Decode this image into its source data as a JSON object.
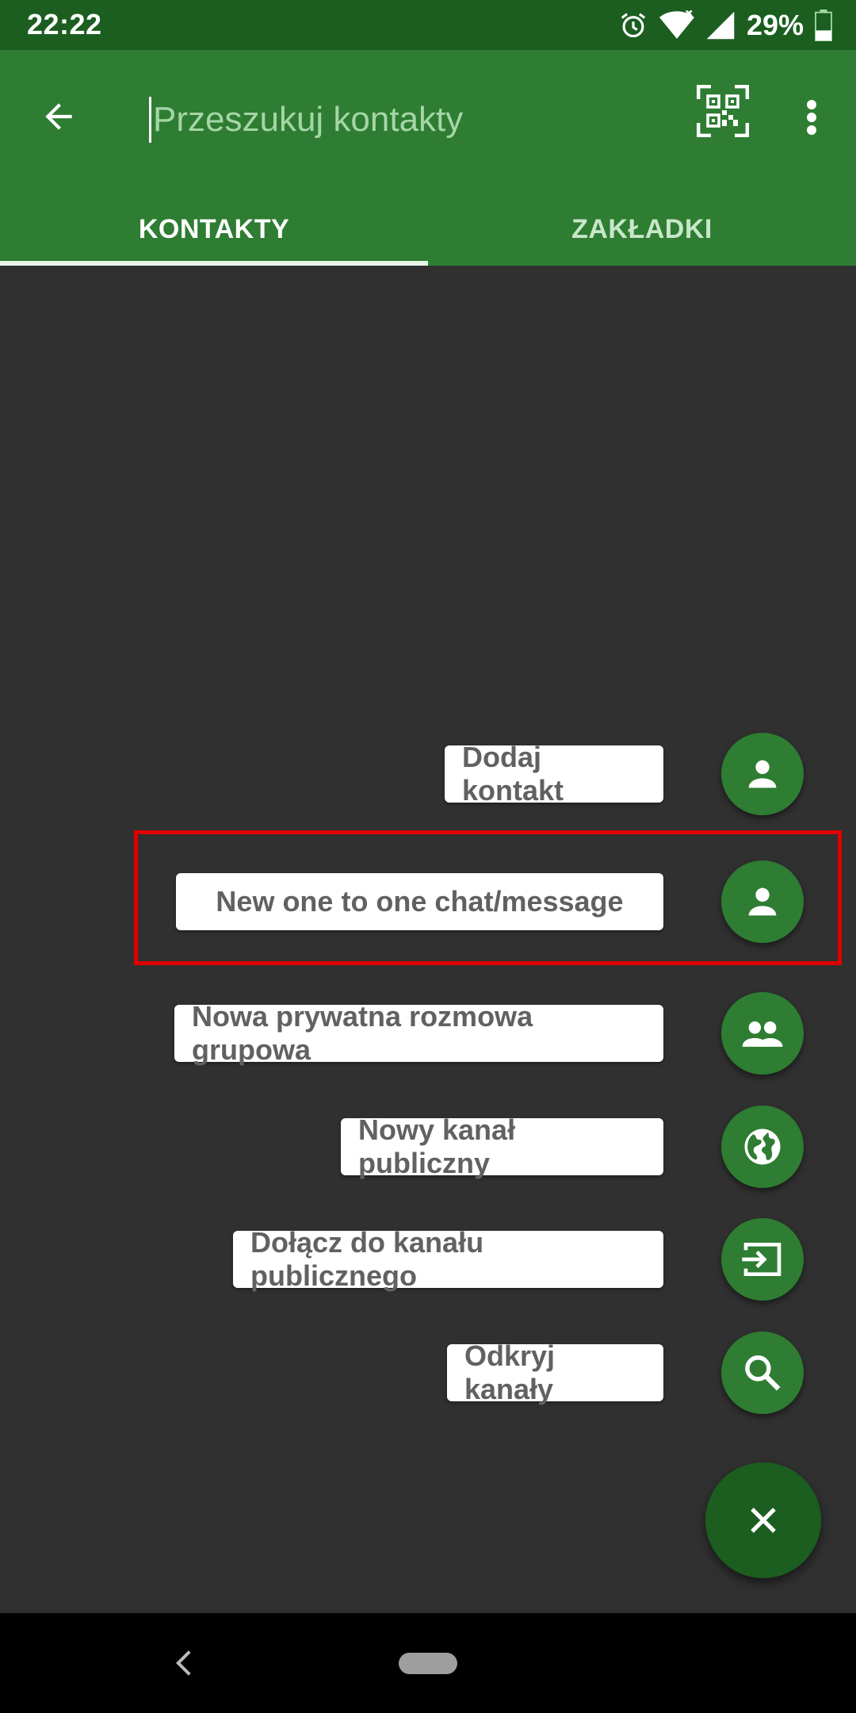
{
  "status_bar": {
    "time": "22:22",
    "battery": "29%",
    "icons": [
      "alarm-icon",
      "wifi-icon",
      "signal-icon",
      "battery-icon"
    ]
  },
  "app_bar": {
    "back_icon": "arrow-back-icon",
    "search_placeholder": "Przeszukuj kontakty",
    "qr_icon": "qr-code-icon",
    "overflow_icon": "more-vert-icon",
    "tabs": [
      {
        "label": "KONTAKTY",
        "active": true
      },
      {
        "label": "ZAKŁADKI",
        "active": false
      }
    ]
  },
  "fab_menu": {
    "items": [
      {
        "label": "Dodaj kontakt",
        "icon": "person-icon"
      },
      {
        "label": "New one to one chat/message",
        "icon": "person-icon"
      },
      {
        "label": "Nowa prywatna rozmowa grupowa",
        "icon": "group-icon"
      },
      {
        "label": "Nowy kanał publiczny",
        "icon": "globe-icon"
      },
      {
        "label": "Dołącz do kanału publicznego",
        "icon": "input-icon"
      },
      {
        "label": "Odkryj kanały",
        "icon": "search-icon"
      }
    ],
    "close_icon": "close-icon"
  },
  "colors": {
    "primary": "#2e7d32",
    "primary_dark": "#1b5e20",
    "background": "#303030",
    "highlight": "#e00000"
  },
  "nav_bar": {
    "back_icon": "nav-back-icon",
    "home_icon": "nav-home-pill"
  }
}
